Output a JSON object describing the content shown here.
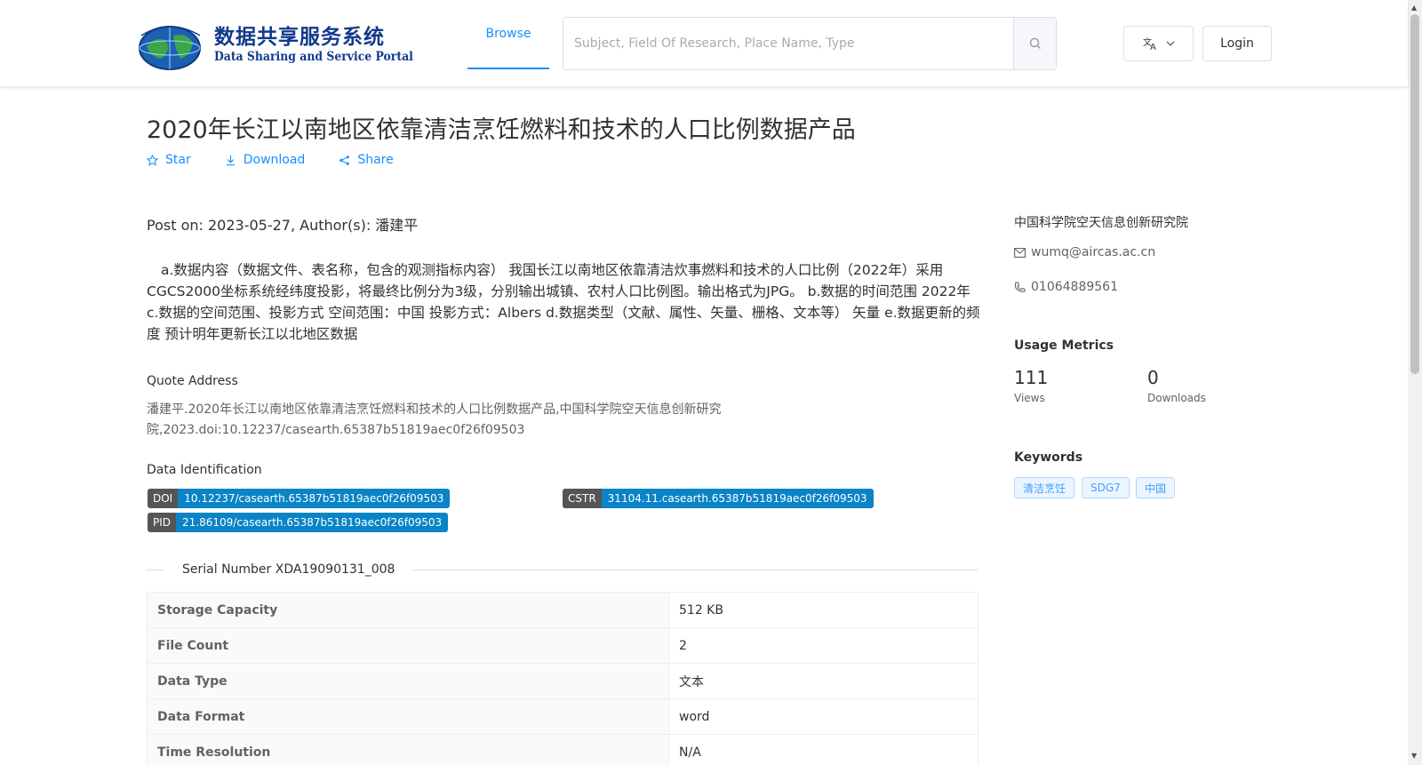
{
  "header": {
    "logo_cn": "数据共享服务系统",
    "logo_en": "Data Sharing and Service Portal",
    "nav_browse": "Browse",
    "search_placeholder": "Subject, Field Of Research, Place Name, Type",
    "login_label": "Login",
    "icons": {
      "search": "search-icon",
      "language": "translate-icon",
      "dropdown": "chevron-down-icon"
    }
  },
  "dataset": {
    "title": "2020年长江以南地区依靠清洁烹饪燃料和技术的人口比例数据产品",
    "actions": {
      "star": "Star",
      "download": "Download",
      "share": "Share"
    },
    "post_on": "Post on: 2023-05-27, Author(s): 潘建平",
    "description": "a.数据内容（数据文件、表名称，包含的观测指标内容） 我国长江以南地区依靠清洁炊事燃料和技术的人口比例（2022年）采用CGCS2000坐标系统经纬度投影，将最终比例分为3级，分别输出城镇、农村人口比例图。输出格式为JPG。 b.数据的时间范围 2022年 c.数据的空间范围、投影方式 空间范围：中国 投影方式：Albers d.数据类型（文献、属性、矢量、栅格、文本等） 矢量 e.数据更新的频度 预计明年更新长江以北地区数据",
    "quote_label": "Quote Address",
    "quote_text": "潘建平.2020年长江以南地区依靠清洁烹饪燃料和技术的人口比例数据产品,中国科学院空天信息创新研究院,2023.doi:10.12237/casearth.65387b51819aec0f26f09503",
    "identification_label": "Data Identification",
    "doi": {
      "key": "DOI",
      "value": "10.12237/casearth.65387b51819aec0f26f09503"
    },
    "cstr": {
      "key": "CSTR",
      "value": "31104.11.casearth.65387b51819aec0f26f09503"
    },
    "pid": {
      "key": "PID",
      "value": "21.86109/casearth.65387b51819aec0f26f09503"
    },
    "serial_number": "Serial Number XDA19090131_008",
    "properties": [
      {
        "key": "Storage Capacity",
        "value": "512 KB"
      },
      {
        "key": "File Count",
        "value": "2"
      },
      {
        "key": "Data Type",
        "value": "文本"
      },
      {
        "key": "Data Format",
        "value": "word"
      },
      {
        "key": "Time Resolution",
        "value": "N/A"
      }
    ]
  },
  "sidebar": {
    "organization": "中国科学院空天信息创新研究院",
    "email": "wumq@aircas.ac.cn",
    "phone": "01064889561",
    "metrics_title": "Usage Metrics",
    "views_value": "111",
    "views_label": "Views",
    "downloads_value": "0",
    "downloads_label": "Downloads",
    "keywords_title": "Keywords",
    "keywords": [
      "清洁烹饪",
      "SDG7",
      "中国"
    ]
  },
  "colors": {
    "accent": "#1890ff",
    "badge_value": "#0a84c6",
    "badge_key": "#555555",
    "logo": "#123a8c"
  }
}
